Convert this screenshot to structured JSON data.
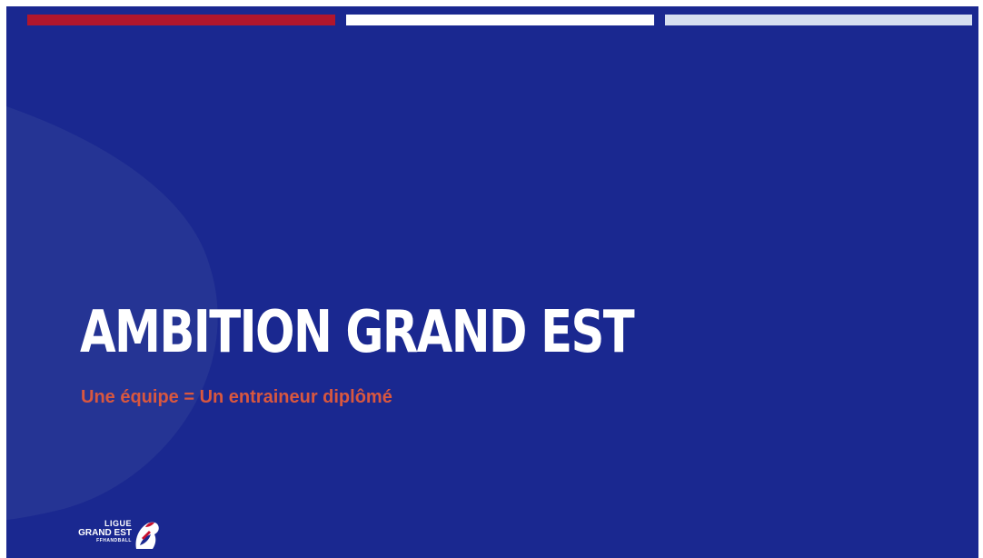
{
  "slide": {
    "title": "AMBITION GRAND EST",
    "subtitle": "Une équipe = Un entraineur diplômé"
  },
  "logo": {
    "line1": "LIGUE",
    "line2": "GRAND EST",
    "line3": "FFHANDBALL",
    "icon": "rooster-emblem-icon"
  },
  "colors": {
    "background": "#1a2890",
    "stripe_red": "#b1162c",
    "stripe_white": "#ffffff",
    "stripe_light": "#d6dff0",
    "subtitle": "#d9573f"
  }
}
